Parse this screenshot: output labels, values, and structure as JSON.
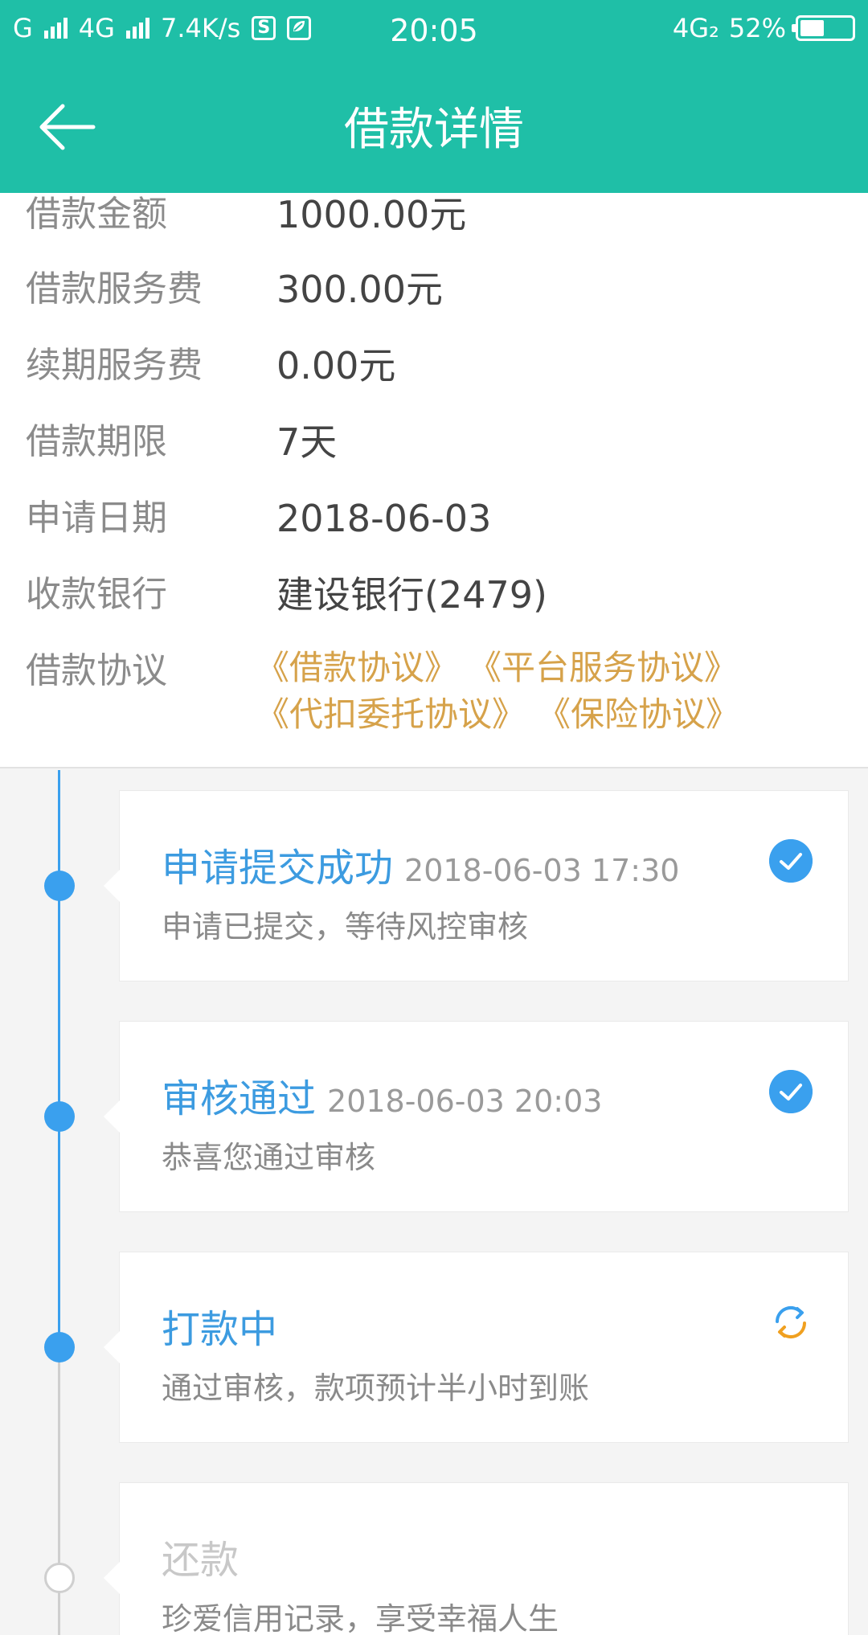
{
  "status_bar": {
    "carrier_left": "G",
    "network_4g": "4G",
    "speed": "7.4K/s",
    "box_icon_letter": "S",
    "time": "20:05",
    "network_right": "4G₂",
    "battery": "52%",
    "battery_level": 0.52
  },
  "header": {
    "title": "借款详情"
  },
  "info": {
    "rows": [
      {
        "label": "借款金额",
        "value": "1000.00元"
      },
      {
        "label": "借款服务费",
        "value": "300.00元"
      },
      {
        "label": "续期服务费",
        "value": "0.00元"
      },
      {
        "label": "借款期限",
        "value": "7天"
      },
      {
        "label": "申请日期",
        "value": "2018-06-03"
      },
      {
        "label": "收款银行",
        "value": "建设银行(2479)"
      }
    ],
    "agreement_label": "借款协议",
    "agreements": [
      "《借款协议》",
      "《平台服务协议》",
      "《代扣委托协议》",
      "《保险协议》"
    ]
  },
  "timeline": [
    {
      "title": "申请提交成功",
      "time": "2018-06-03 17:30",
      "desc": "申请已提交，等待风控审核",
      "state": "done",
      "icon": "check-icon"
    },
    {
      "title": "审核通过",
      "time": "2018-06-03 20:03",
      "desc": "恭喜您通过审核",
      "state": "done",
      "icon": "check-icon"
    },
    {
      "title": "打款中",
      "time": "",
      "desc": "通过审核，款项预计半小时到账",
      "state": "in-progress",
      "icon": "refresh-icon"
    },
    {
      "title": "还款",
      "time": "",
      "desc": "珍爱信用记录，享受幸福人生",
      "state": "pending",
      "icon": ""
    }
  ],
  "colors": {
    "header_bg": "#1fbfa7",
    "accent_blue": "#3aa0ee",
    "agreement_gold": "#d6a24a",
    "refresh_orange": "#f0a020"
  }
}
